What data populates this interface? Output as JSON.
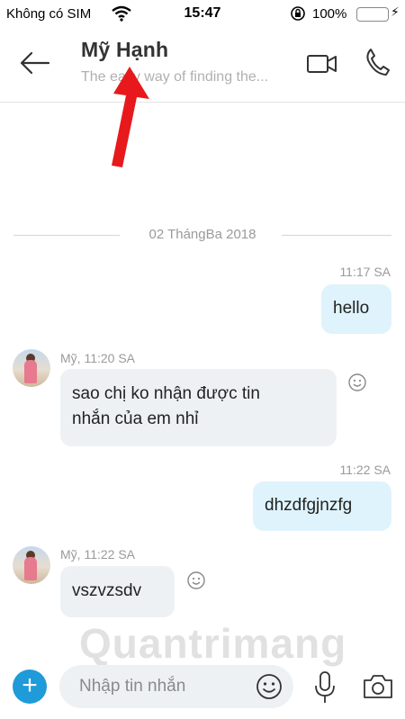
{
  "status_bar": {
    "carrier": "Không có SIM",
    "time": "15:47",
    "battery_percent": "100%",
    "battery_level": 1.0
  },
  "header": {
    "contact_name": "Mỹ Hạnh",
    "mood_message": "The easy way of finding the..."
  },
  "date_divider": "02 ThángBa 2018",
  "messages": [
    {
      "direction": "outgoing",
      "time": "11:17 SA",
      "text": "hello"
    },
    {
      "direction": "incoming",
      "sender_time": "Mỹ, 11:20 SA",
      "text_line1": "sao chị ko nhận được tin",
      "text_line2": "nhắn của em nhỉ"
    },
    {
      "direction": "outgoing",
      "time": "11:22 SA",
      "text": "dhzdfgjnzfg"
    },
    {
      "direction": "incoming",
      "sender_time": "Mỹ, 11:22 SA",
      "text": "vszvzsdv"
    }
  ],
  "input": {
    "placeholder": "Nhập tin nhắn"
  },
  "watermark": "Quantrimang",
  "icons": {
    "back": "back-arrow-icon",
    "video": "video-call-icon",
    "phone": "phone-icon",
    "add": "plus-icon",
    "emoji": "emoji-icon",
    "mic": "microphone-icon",
    "camera": "camera-icon",
    "react": "smiley-reaction-icon"
  },
  "colors": {
    "accent": "#1e9bd8",
    "outgoing_bubble": "#dff3fc",
    "incoming_bubble": "#eef1f4",
    "annotation_arrow": "#e8191c"
  }
}
